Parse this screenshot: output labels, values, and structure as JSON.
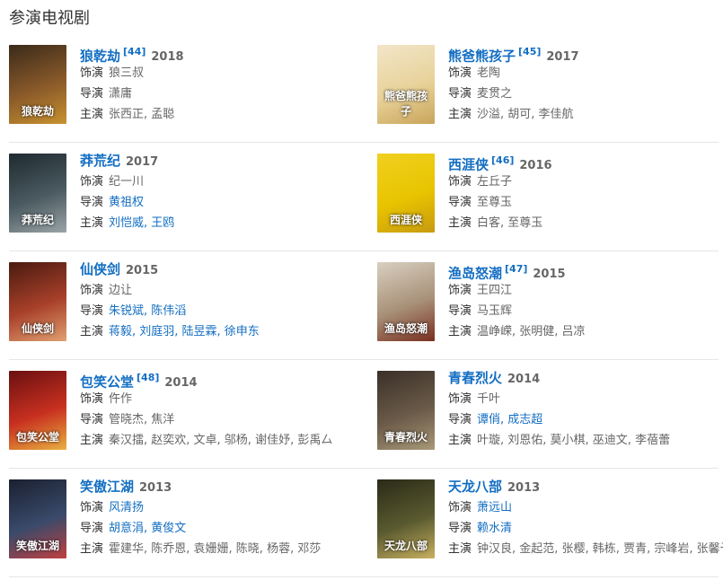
{
  "section_title": "参演电视剧",
  "labels": {
    "role": "饰演",
    "director": "导演",
    "cast": "主演"
  },
  "works": [
    {
      "title": "狼乾劫",
      "ref": "[44]",
      "year": "2018",
      "role": "狼三叔",
      "role_link": false,
      "director": "潇庸",
      "director_link": false,
      "cast": "张西正, 孟聪",
      "cast_link": false,
      "poster_colors": [
        "#3a2a1a",
        "#8a5a2a",
        "#c8922f"
      ],
      "poster_text": "狼乾劫"
    },
    {
      "title": "熊爸熊孩子",
      "ref": "[45]",
      "year": "2017",
      "role": "老陶",
      "role_link": false,
      "director": "麦贯之",
      "director_link": false,
      "cast": "沙溢, 胡可, 李佳航",
      "cast_link": false,
      "poster_colors": [
        "#f2e6c8",
        "#e8d29a",
        "#c9a45a"
      ],
      "poster_text": "熊爸熊孩子"
    },
    {
      "title": "莽荒纪",
      "ref": "",
      "year": "2017",
      "role": "纪一川",
      "role_link": false,
      "director": "黄祖权",
      "director_link": true,
      "cast": "刘恺威, 王鸥",
      "cast_link": true,
      "poster_colors": [
        "#1e2a30",
        "#4a5a60",
        "#9aa4a8"
      ],
      "poster_text": "莽荒纪"
    },
    {
      "title": "西涯侠",
      "ref": "[46]",
      "year": "2016",
      "role": "左丘子",
      "role_link": false,
      "director": "至尊玉",
      "director_link": false,
      "cast": "白客, 至尊玉",
      "cast_link": false,
      "poster_colors": [
        "#f0d020",
        "#e8c400",
        "#c89a10"
      ],
      "poster_text": "西涯侠"
    },
    {
      "title": "仙侠剑",
      "ref": "",
      "year": "2015",
      "role": "边让",
      "role_link": false,
      "director": "朱锐斌, 陈伟滔",
      "director_link": true,
      "cast": "蒋毅, 刘庭羽, 陆昱霖, 徐申东",
      "cast_link": true,
      "poster_colors": [
        "#4a1a10",
        "#a8402a",
        "#e0a070"
      ],
      "poster_text": "仙侠剑"
    },
    {
      "title": "渔岛怒潮",
      "ref": "[47]",
      "year": "2015",
      "role": "王四江",
      "role_link": false,
      "director": "马玉辉",
      "director_link": false,
      "cast": "温峥嵘, 张明健, 吕凉",
      "cast_link": false,
      "poster_colors": [
        "#d8d0c0",
        "#a89078",
        "#7a3020"
      ],
      "poster_text": "渔岛怒潮"
    },
    {
      "title": "包笑公堂",
      "ref": "[48]",
      "year": "2014",
      "role": "仵作",
      "role_link": false,
      "director": "管晓杰, 焦洋",
      "director_link": false,
      "cast": "秦汉擂, 赵奕欢, 文卓, 邬杨, 谢佳妤, 彭禹厶",
      "cast_link": false,
      "poster_colors": [
        "#6a1010",
        "#c83020",
        "#e8b040"
      ],
      "poster_text": "包笑公堂"
    },
    {
      "title": "青春烈火",
      "ref": "",
      "year": "2014",
      "role": "千叶",
      "role_link": false,
      "director": "谭俏, 成志超",
      "director_link": true,
      "cast": "叶璇, 刘恩佑, 莫小棋, 巫迪文, 李蓓蕾",
      "cast_link": false,
      "poster_colors": [
        "#3a3028",
        "#6a5a48",
        "#a89878"
      ],
      "poster_text": "青春烈火"
    },
    {
      "title": "笑傲江湖",
      "ref": "",
      "year": "2013",
      "role": "风清扬",
      "role_link": true,
      "director": "胡意涓, 黄俊文",
      "director_link": true,
      "cast": "霍建华, 陈乔恩, 袁姗姗, 陈晓, 杨蓉, 邓莎",
      "cast_link": false,
      "poster_colors": [
        "#1a2030",
        "#3a4a6a",
        "#c04040"
      ],
      "poster_text": "笑傲江湖"
    },
    {
      "title": "天龙八部",
      "ref": "",
      "year": "2013",
      "role": "萧远山",
      "role_link": true,
      "director": "赖水清",
      "director_link": true,
      "cast": "钟汉良, 金起范, 张樱, 韩栋, 贾青, 宗峰岩, 张馨予",
      "cast_link": false,
      "poster_colors": [
        "#2a2a18",
        "#5a5a30",
        "#c8b060"
      ],
      "poster_text": "天龙八部"
    }
  ]
}
